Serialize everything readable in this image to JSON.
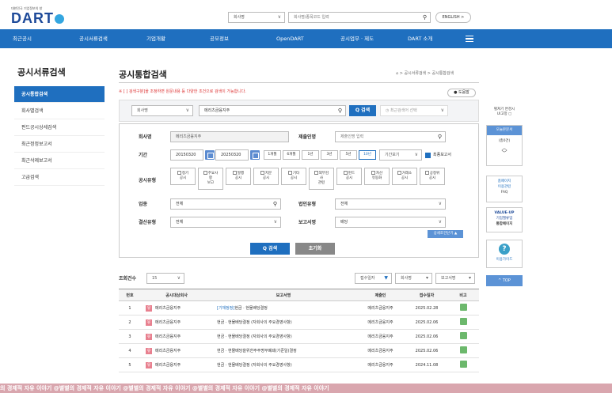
{
  "header": {
    "logo_small": "대한민국 기업정보의 창",
    "logo": "DART",
    "search_type": "회사명",
    "search_placeholder": "회사명/종목코드 입력",
    "english_label": "ENGLISH >"
  },
  "nav": {
    "items": [
      "최근공시",
      "공시서류검색",
      "기업개황",
      "공모정보",
      "OpenDART",
      "공시업무 · 제도",
      "DART 소개"
    ]
  },
  "sidebar": {
    "title": "공시서류검색",
    "items": [
      "공시통합검색",
      "회사별검색",
      "펀드공시상세검색",
      "최근정정보고서",
      "최근삭제보고서",
      "고급검색"
    ]
  },
  "main": {
    "title": "공시통합검색",
    "breadcrumb": "⌂ > 공시서류검색 > 공시통합검색",
    "notice": "※ [ ] 검색구분]을 조정하면 원문내용 등 다양한 조건으로 검색이 가능합니다.",
    "help_label": "● 도움말",
    "top_select": "회사명",
    "top_input": "메리츠금융지주",
    "search_btn": "Q 검색",
    "recent_label": "◷ 최근검색어 선택"
  },
  "form": {
    "company_label": "회사명",
    "company_value": "메리츠금융지주",
    "report_label": "제출인명",
    "report_placeholder": "제출인명 입력",
    "period_label": "기간",
    "start_date": "20150320",
    "end_date": "20250320",
    "dash": "-",
    "period_buttons": [
      "1개월",
      "6개월",
      "1년",
      "3년",
      "5년",
      "10년"
    ],
    "period_select": "기간보기",
    "final_report": "최종보고서",
    "type_label": "공시유형",
    "types": [
      [
        "정기",
        "공시"
      ],
      [
        "주요사",
        "항",
        "보고"
      ],
      [
        "발행",
        "공시"
      ],
      [
        "지분",
        "공시"
      ],
      [
        "기타",
        "공시"
      ],
      [
        "외부감",
        "사",
        "관련"
      ],
      [
        "펀드",
        "공시"
      ],
      [
        "자산",
        "유동화"
      ],
      [
        "거래소",
        "공시"
      ],
      [
        "공정위",
        "공시"
      ]
    ],
    "industry_label": "업종",
    "industry_value": "전체",
    "corp_type_label": "법인유형",
    "corp_type_value": "전체",
    "fiscal_label": "결산유형",
    "fiscal_value": "전체",
    "report_name_label": "보고서명",
    "report_name_value": "배당",
    "detail_btn": "상세조건닫기 ▲",
    "submit": "Q 검색",
    "reset": "초기화"
  },
  "results": {
    "count_label": "조회건수",
    "count_value": "15",
    "sort1": "접수일자",
    "sort2": "회사명",
    "sort3": "보고서명",
    "headers": [
      "번호",
      "공시대상회사",
      "보고서명",
      "제출인",
      "접수일자",
      "비고"
    ],
    "rows": [
      {
        "no": "1",
        "company": "메리츠금융지주",
        "tag": "[기재정정]",
        "report": "현금 · 현물배당결정",
        "filer": "메리츠금융지주",
        "date": "2025.02.28"
      },
      {
        "no": "2",
        "company": "메리츠금융지주",
        "tag": "",
        "report": "현금 · 현물배당결정 (자회사의 주요경영사항)",
        "filer": "메리츠금융지주",
        "date": "2025.02.06"
      },
      {
        "no": "3",
        "company": "메리츠금융지주",
        "tag": "",
        "report": "현금 · 현물배당결정 (자회사의 주요경영사항)",
        "filer": "메리츠금융지주",
        "date": "2025.02.06"
      },
      {
        "no": "4",
        "company": "메리츠금융지주",
        "tag": "",
        "report": "현금 · 현물배당을위한주주명부폐쇄(기준일)결정",
        "filer": "메리츠금융지주",
        "date": "2025.02.06"
      },
      {
        "no": "5",
        "company": "메리츠금융지주",
        "tag": "",
        "report": "현금 · 현물배당결정 (자회사의 주요경영사항)",
        "filer": "메리츠금융지주",
        "date": "2024.11.08"
      }
    ]
  },
  "right_panel": {
    "collapse_label": "펼쳐기 변경시",
    "ui_label": "UI고정 ▢",
    "recent_docs": "오늘본문서",
    "count": "(총0건)",
    "homepage": [
      "홈페이지",
      "이용관련",
      "FAQ"
    ],
    "value_up": [
      "VALUE-UP",
      "기업밸류업",
      "통합페이지"
    ],
    "guide": "이용가이드",
    "top": "^ TOP"
  },
  "watermark": "의 경제적 자유 이야기 @별별의 경제적 자유 이야기      @별별의 경제적 자유 이야기      @별별의 경제적 자유 이야기      @별별의 경제적 자유 이야기"
}
